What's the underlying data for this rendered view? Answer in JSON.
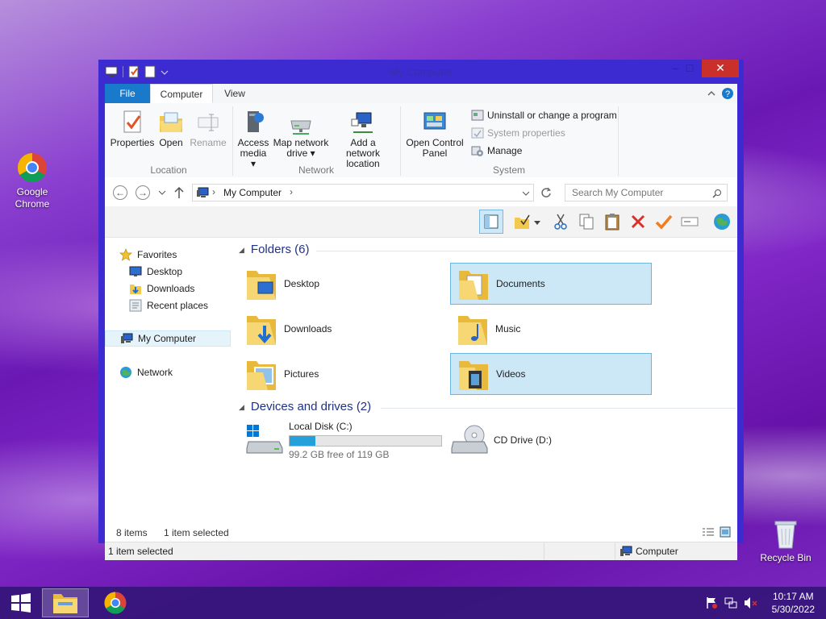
{
  "desktop": {
    "icons": [
      {
        "label": "Google Chrome",
        "icon": "chrome-icon"
      },
      {
        "label": "Recycle Bin",
        "icon": "recycle-bin-icon"
      }
    ]
  },
  "window": {
    "title": "My Computer",
    "tabs": {
      "file": "File",
      "computer": "Computer",
      "view": "View"
    },
    "ribbon": {
      "location": {
        "label": "Location",
        "properties": "Properties",
        "open": "Open",
        "rename": "Rename"
      },
      "network": {
        "label": "Network",
        "access_media": [
          "Access",
          "media"
        ],
        "map_drive": [
          "Map network",
          "drive"
        ],
        "add_location": [
          "Add a network",
          "location"
        ]
      },
      "system": {
        "label": "System",
        "open_control_panel": [
          "Open Control",
          "Panel"
        ],
        "uninstall": "Uninstall or change a program",
        "system_properties": "System properties",
        "manage": "Manage"
      }
    },
    "address": {
      "path": "My Computer",
      "search_placeholder": "Search My Computer"
    },
    "nav": {
      "favorites": "Favorites",
      "favorites_items": [
        "Desktop",
        "Downloads",
        "Recent places"
      ],
      "computer": "My Computer",
      "network": "Network"
    },
    "folders": {
      "heading": "Folders (6)",
      "items": [
        {
          "name": "Desktop",
          "selected": false
        },
        {
          "name": "Documents",
          "selected": true
        },
        {
          "name": "Downloads",
          "selected": false
        },
        {
          "name": "Music",
          "selected": false
        },
        {
          "name": "Pictures",
          "selected": false
        },
        {
          "name": "Videos",
          "selected": true
        }
      ]
    },
    "drives": {
      "heading": "Devices and drives (2)",
      "local": {
        "name": "Local Disk (C:)",
        "free": "99.2 GB free of 119 GB",
        "used_fraction": 0.17
      },
      "cd": {
        "name": "CD Drive (D:)"
      }
    },
    "status": {
      "items": "8 items",
      "selected": "1 item selected",
      "bottom_left": "1 item selected",
      "bottom_right": "Computer"
    }
  },
  "taskbar": {
    "time": "10:17 AM",
    "date": "5/30/2022"
  },
  "colors": {
    "accent": "#1979ca",
    "window_frame": "#3b2bd0",
    "selection": "#cce8f7",
    "close": "#c9302c"
  }
}
